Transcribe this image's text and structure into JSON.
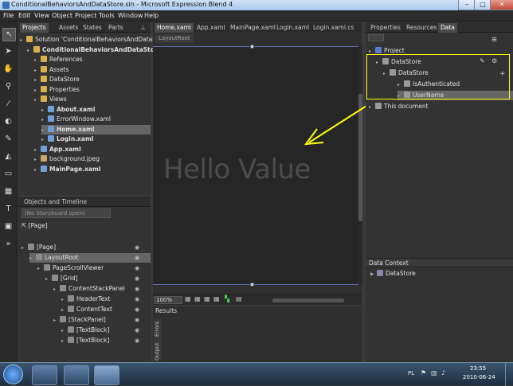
{
  "window": {
    "title": "ConditionalBehaviorsAndDataStore.sln - Microsoft Expression Blend 4",
    "minimize": "–",
    "maximize": "□",
    "close": "✕"
  },
  "menu": [
    "File",
    "Edit",
    "View",
    "Object",
    "Project",
    "Tools",
    "Window",
    "Help"
  ],
  "projects_panel": {
    "tabs": [
      "Projects",
      "Assets",
      "States",
      "Parts"
    ],
    "items": [
      {
        "label": "Solution 'ConditionalBehaviorsAndDataStore'",
        "bold": false,
        "indent": 0
      },
      {
        "label": "ConditionalBehaviorsAndDataStore",
        "bold": true,
        "indent": 1
      },
      {
        "label": "References",
        "bold": false,
        "indent": 2
      },
      {
        "label": "Assets",
        "bold": false,
        "indent": 2
      },
      {
        "label": "DataStore",
        "bold": false,
        "indent": 2
      },
      {
        "label": "Properties",
        "bold": false,
        "indent": 2
      },
      {
        "label": "Views",
        "bold": false,
        "indent": 2
      },
      {
        "label": "About.xaml",
        "bold": true,
        "indent": 3
      },
      {
        "label": "ErrorWindow.xaml",
        "bold": false,
        "indent": 3
      },
      {
        "label": "Home.xaml",
        "bold": true,
        "indent": 3,
        "selected": true
      },
      {
        "label": "Login.xaml",
        "bold": true,
        "indent": 3
      },
      {
        "label": "App.xaml",
        "bold": true,
        "indent": 2
      },
      {
        "label": "background.jpeg",
        "bold": false,
        "indent": 2
      },
      {
        "label": "MainPage.xaml",
        "bold": true,
        "indent": 2
      }
    ]
  },
  "timeline_panel": {
    "title": "Objects and Timeline",
    "storyboard": "(No Storyboard open)",
    "page_label": "[Page]",
    "items": [
      {
        "label": "[Page]",
        "indent": 0
      },
      {
        "label": "LayoutRoot",
        "indent": 1,
        "selected": true
      },
      {
        "label": "PageScrollViewer",
        "indent": 2
      },
      {
        "label": "[Grid]",
        "indent": 3
      },
      {
        "label": "ContentStackPanel",
        "indent": 4
      },
      {
        "label": "HeaderText",
        "indent": 5
      },
      {
        "label": "ContentText",
        "indent": 5
      },
      {
        "label": "[StackPanel]",
        "indent": 4
      },
      {
        "label": "[TextBlock]",
        "indent": 5
      },
      {
        "label": "[TextBlock]",
        "indent": 5
      }
    ]
  },
  "document": {
    "tabs": [
      "Home.xaml",
      "App.xaml",
      "MainPage.xaml",
      "Login.xaml",
      "Login.xaml.cs"
    ],
    "breadcrumb": "LayoutRoot",
    "canvas_text": "Hello Value",
    "zoom": "100%",
    "results_title": "Results",
    "results_tabs": [
      "Errors",
      "Output"
    ]
  },
  "right_panel": {
    "tabs": [
      "Properties",
      "Resources",
      "Data"
    ],
    "tree": [
      {
        "label": "Project",
        "indent": 0
      },
      {
        "label": "DataStore",
        "indent": 1
      },
      {
        "label": "DataStore",
        "indent": 2
      },
      {
        "label": "IsAuthenticated",
        "indent": 4
      },
      {
        "label": "UserName",
        "indent": 4,
        "selected": true
      },
      {
        "label": "This document",
        "indent": 0
      }
    ],
    "data_context_title": "Data Context",
    "data_context_items": [
      "DataStore"
    ]
  },
  "taskbar": {
    "lang": "PL",
    "time": "23:55",
    "date": "2010-06-24"
  },
  "colors": {
    "annotation": "#ffff00",
    "selection": "#666666",
    "canvas_border": "#5b6fa8"
  }
}
